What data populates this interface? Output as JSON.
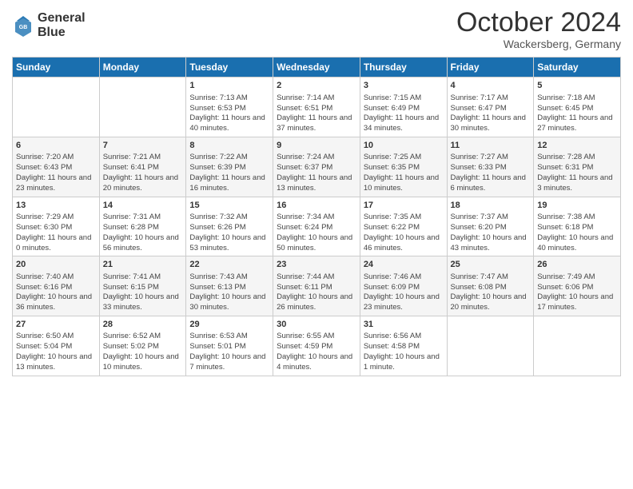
{
  "logo": {
    "line1": "General",
    "line2": "Blue"
  },
  "title": "October 2024",
  "location": "Wackersberg, Germany",
  "days_of_week": [
    "Sunday",
    "Monday",
    "Tuesday",
    "Wednesday",
    "Thursday",
    "Friday",
    "Saturday"
  ],
  "weeks": [
    [
      {
        "day": "",
        "content": ""
      },
      {
        "day": "",
        "content": ""
      },
      {
        "day": "1",
        "content": "Sunrise: 7:13 AM\nSunset: 6:53 PM\nDaylight: 11 hours and 40 minutes."
      },
      {
        "day": "2",
        "content": "Sunrise: 7:14 AM\nSunset: 6:51 PM\nDaylight: 11 hours and 37 minutes."
      },
      {
        "day": "3",
        "content": "Sunrise: 7:15 AM\nSunset: 6:49 PM\nDaylight: 11 hours and 34 minutes."
      },
      {
        "day": "4",
        "content": "Sunrise: 7:17 AM\nSunset: 6:47 PM\nDaylight: 11 hours and 30 minutes."
      },
      {
        "day": "5",
        "content": "Sunrise: 7:18 AM\nSunset: 6:45 PM\nDaylight: 11 hours and 27 minutes."
      }
    ],
    [
      {
        "day": "6",
        "content": "Sunrise: 7:20 AM\nSunset: 6:43 PM\nDaylight: 11 hours and 23 minutes."
      },
      {
        "day": "7",
        "content": "Sunrise: 7:21 AM\nSunset: 6:41 PM\nDaylight: 11 hours and 20 minutes."
      },
      {
        "day": "8",
        "content": "Sunrise: 7:22 AM\nSunset: 6:39 PM\nDaylight: 11 hours and 16 minutes."
      },
      {
        "day": "9",
        "content": "Sunrise: 7:24 AM\nSunset: 6:37 PM\nDaylight: 11 hours and 13 minutes."
      },
      {
        "day": "10",
        "content": "Sunrise: 7:25 AM\nSunset: 6:35 PM\nDaylight: 11 hours and 10 minutes."
      },
      {
        "day": "11",
        "content": "Sunrise: 7:27 AM\nSunset: 6:33 PM\nDaylight: 11 hours and 6 minutes."
      },
      {
        "day": "12",
        "content": "Sunrise: 7:28 AM\nSunset: 6:31 PM\nDaylight: 11 hours and 3 minutes."
      }
    ],
    [
      {
        "day": "13",
        "content": "Sunrise: 7:29 AM\nSunset: 6:30 PM\nDaylight: 11 hours and 0 minutes."
      },
      {
        "day": "14",
        "content": "Sunrise: 7:31 AM\nSunset: 6:28 PM\nDaylight: 10 hours and 56 minutes."
      },
      {
        "day": "15",
        "content": "Sunrise: 7:32 AM\nSunset: 6:26 PM\nDaylight: 10 hours and 53 minutes."
      },
      {
        "day": "16",
        "content": "Sunrise: 7:34 AM\nSunset: 6:24 PM\nDaylight: 10 hours and 50 minutes."
      },
      {
        "day": "17",
        "content": "Sunrise: 7:35 AM\nSunset: 6:22 PM\nDaylight: 10 hours and 46 minutes."
      },
      {
        "day": "18",
        "content": "Sunrise: 7:37 AM\nSunset: 6:20 PM\nDaylight: 10 hours and 43 minutes."
      },
      {
        "day": "19",
        "content": "Sunrise: 7:38 AM\nSunset: 6:18 PM\nDaylight: 10 hours and 40 minutes."
      }
    ],
    [
      {
        "day": "20",
        "content": "Sunrise: 7:40 AM\nSunset: 6:16 PM\nDaylight: 10 hours and 36 minutes."
      },
      {
        "day": "21",
        "content": "Sunrise: 7:41 AM\nSunset: 6:15 PM\nDaylight: 10 hours and 33 minutes."
      },
      {
        "day": "22",
        "content": "Sunrise: 7:43 AM\nSunset: 6:13 PM\nDaylight: 10 hours and 30 minutes."
      },
      {
        "day": "23",
        "content": "Sunrise: 7:44 AM\nSunset: 6:11 PM\nDaylight: 10 hours and 26 minutes."
      },
      {
        "day": "24",
        "content": "Sunrise: 7:46 AM\nSunset: 6:09 PM\nDaylight: 10 hours and 23 minutes."
      },
      {
        "day": "25",
        "content": "Sunrise: 7:47 AM\nSunset: 6:08 PM\nDaylight: 10 hours and 20 minutes."
      },
      {
        "day": "26",
        "content": "Sunrise: 7:49 AM\nSunset: 6:06 PM\nDaylight: 10 hours and 17 minutes."
      }
    ],
    [
      {
        "day": "27",
        "content": "Sunrise: 6:50 AM\nSunset: 5:04 PM\nDaylight: 10 hours and 13 minutes."
      },
      {
        "day": "28",
        "content": "Sunrise: 6:52 AM\nSunset: 5:02 PM\nDaylight: 10 hours and 10 minutes."
      },
      {
        "day": "29",
        "content": "Sunrise: 6:53 AM\nSunset: 5:01 PM\nDaylight: 10 hours and 7 minutes."
      },
      {
        "day": "30",
        "content": "Sunrise: 6:55 AM\nSunset: 4:59 PM\nDaylight: 10 hours and 4 minutes."
      },
      {
        "day": "31",
        "content": "Sunrise: 6:56 AM\nSunset: 4:58 PM\nDaylight: 10 hours and 1 minute."
      },
      {
        "day": "",
        "content": ""
      },
      {
        "day": "",
        "content": ""
      }
    ]
  ]
}
